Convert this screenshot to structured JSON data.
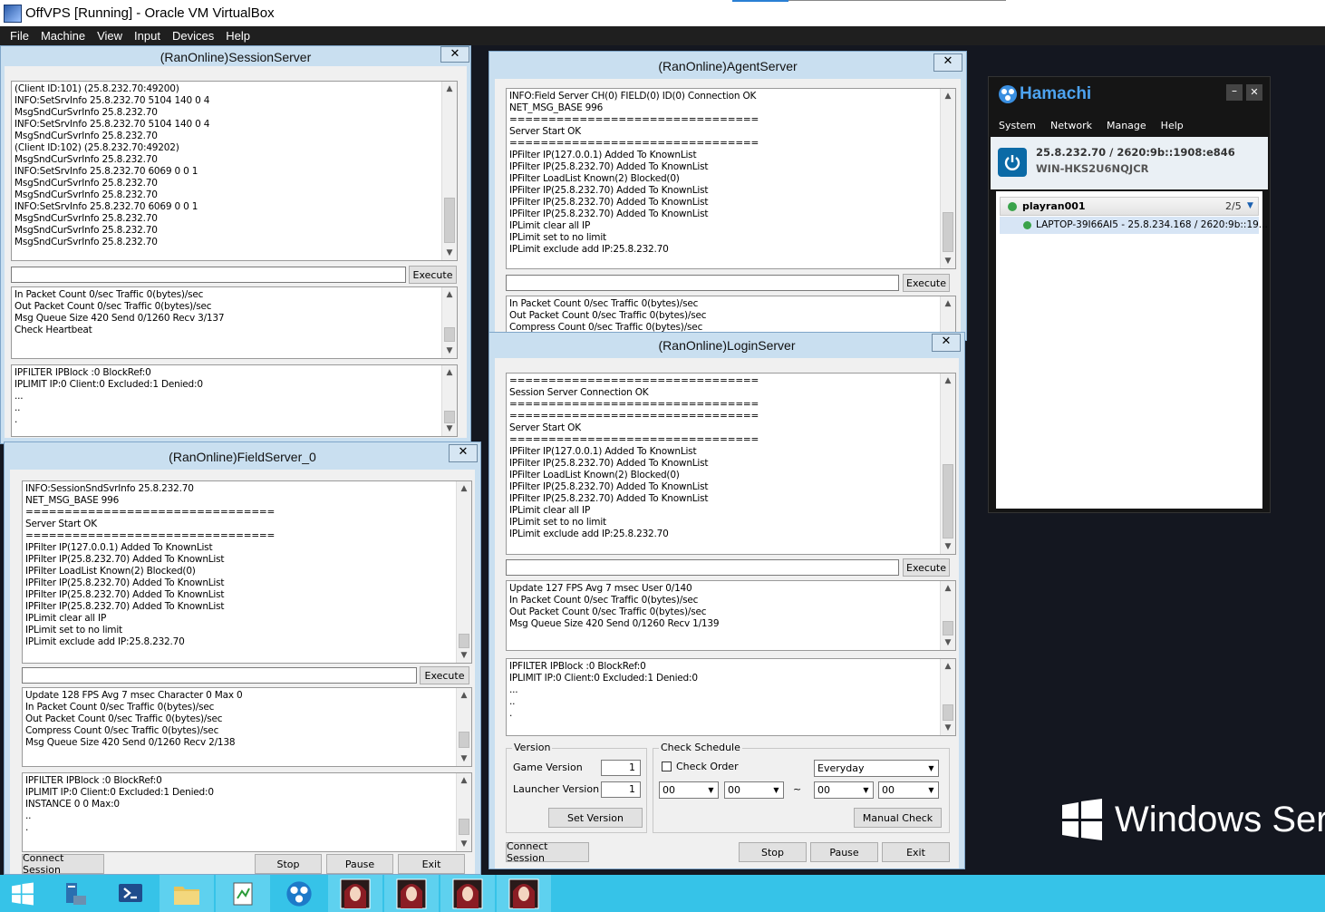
{
  "vbox": {
    "title": "OffVPS [Running] - Oracle VM VirtualBox",
    "menu": [
      "File",
      "Machine",
      "View",
      "Input",
      "Devices",
      "Help"
    ]
  },
  "common": {
    "execute": "Execute",
    "close_glyph": "✕",
    "up": "▲",
    "down": "▼"
  },
  "session": {
    "title": "(RanOnline)SessionServer",
    "log": [
      "(Client ID:101) (25.8.232.70:49200)",
      "INFO:SetSrvInfo 25.8.232.70 5104 140 0 4",
      "MsgSndCurSvrInfo 25.8.232.70",
      "INFO:SetSrvInfo 25.8.232.70 5104 140 0 4",
      "MsgSndCurSvrInfo 25.8.232.70",
      "(Client ID:102) (25.8.232.70:49202)",
      "MsgSndCurSvrInfo 25.8.232.70",
      "INFO:SetSrvInfo 25.8.232.70 6069 0 0 1",
      "MsgSndCurSvrInfo 25.8.232.70",
      "MsgSndCurSvrInfo 25.8.232.70",
      "INFO:SetSrvInfo 25.8.232.70 6069 0 0 1",
      "MsgSndCurSvrInfo 25.8.232.70",
      "MsgSndCurSvrInfo 25.8.232.70",
      "MsgSndCurSvrInfo 25.8.232.70"
    ],
    "stats": [
      "In Packet Count 0/sec Traffic 0(bytes)/sec",
      "Out Packet Count 0/sec Traffic 0(bytes)/sec",
      "Msg Queue Size 420 Send 0/1260 Recv 3/137",
      "Check Heartbeat"
    ],
    "ipf": [
      "IPFILTER IPBlock :0 BlockRef:0",
      "IPLIMIT IP:0 Client:0 Excluded:1 Denied:0",
      "...",
      "..",
      "."
    ]
  },
  "agent": {
    "title": "(RanOnline)AgentServer",
    "log": [
      "INFO:Field Server CH(0) FIELD(0) ID(0) Connection OK",
      "NET_MSG_BASE 996",
      "================================",
      "Server Start OK",
      "================================",
      "IPFilter IP(127.0.0.1) Added To KnownList",
      "IPFilter IP(25.8.232.70) Added To KnownList",
      "IPFilter LoadList Known(2) Blocked(0)",
      "IPFilter IP(25.8.232.70) Added To KnownList",
      "IPFilter IP(25.8.232.70) Added To KnownList",
      "IPFilter IP(25.8.232.70) Added To KnownList",
      "IPLimit clear all IP",
      "IPLimit set to no limit",
      "IPLimit exclude add IP:25.8.232.70"
    ],
    "stats": [
      "In Packet Count 0/sec Traffic 0(bytes)/sec",
      "Out Packet Count 0/sec Traffic 0(bytes)/sec",
      "Compress Count 0/sec Traffic 0(bytes)/sec"
    ]
  },
  "field": {
    "title": "(RanOnline)FieldServer_0",
    "log": [
      "INFO:SessionSndSvrInfo 25.8.232.70",
      "NET_MSG_BASE 996",
      "================================",
      "Server Start OK",
      "================================",
      "IPFilter IP(127.0.0.1) Added To KnownList",
      "IPFilter IP(25.8.232.70) Added To KnownList",
      "IPFilter LoadList Known(2) Blocked(0)",
      "IPFilter IP(25.8.232.70) Added To KnownList",
      "IPFilter IP(25.8.232.70) Added To KnownList",
      "IPFilter IP(25.8.232.70) Added To KnownList",
      "IPLimit clear all IP",
      "IPLimit set to no limit",
      "IPLimit exclude add IP:25.8.232.70"
    ],
    "stats": [
      "Update 128 FPS Avg 7 msec Character 0 Max 0",
      "In Packet Count 0/sec Traffic 0(bytes)/sec",
      "Out Packet Count 0/sec Traffic 0(bytes)/sec",
      "Compress Count 0/sec Traffic 0(bytes)/sec",
      "Msg Queue Size 420 Send 0/1260 Recv 2/138"
    ],
    "ipf": [
      "IPFILTER IPBlock :0 BlockRef:0",
      "IPLIMIT IP:0 Client:0 Excluded:1 Denied:0",
      "INSTANCE 0 0 Max:0",
      "..",
      "."
    ],
    "buttons": {
      "connect": "Connect Session",
      "stop": "Stop",
      "pause": "Pause",
      "exit": "Exit"
    }
  },
  "login": {
    "title": "(RanOnline)LoginServer",
    "log": [
      "================================",
      "Session Server Connection OK",
      "================================",
      "================================",
      "Server Start OK",
      "================================",
      "IPFilter IP(127.0.0.1) Added To KnownList",
      "IPFilter IP(25.8.232.70) Added To KnownList",
      "IPFilter LoadList Known(2) Blocked(0)",
      "IPFilter IP(25.8.232.70) Added To KnownList",
      "IPFilter IP(25.8.232.70) Added To KnownList",
      "IPLimit clear all IP",
      "IPLimit set to no limit",
      "IPLimit exclude add IP:25.8.232.70"
    ],
    "stats": [
      "Update 127 FPS Avg 7 msec User 0/140",
      "In Packet Count 0/sec Traffic 0(bytes)/sec",
      "Out Packet Count 0/sec Traffic 0(bytes)/sec",
      "Msg Queue Size 420 Send 0/1260 Recv 1/139"
    ],
    "ipf": [
      "IPFILTER IPBlock :0 BlockRef:0",
      "IPLIMIT IP:0 Client:0 Excluded:1 Denied:0",
      "...",
      "..",
      "."
    ],
    "version": {
      "group": "Version",
      "game_label": "Game Version",
      "game_value": "1",
      "launcher_label": "Launcher Version",
      "launcher_value": "1",
      "set_button": "Set Version"
    },
    "schedule": {
      "group": "Check Schedule",
      "check_order": "Check Order",
      "frequency": "Everyday",
      "h1": "00",
      "m1": "00",
      "tilde": "~",
      "h2": "00",
      "m2": "00",
      "manual_button": "Manual Check"
    },
    "buttons": {
      "connect": "Connect Session",
      "stop": "Stop",
      "pause": "Pause",
      "exit": "Exit"
    }
  },
  "hamachi": {
    "logo": "Hamachi",
    "menu": [
      "System",
      "Network",
      "Manage",
      "Help"
    ],
    "ip": "25.8.232.70 / 2620:9b::1908:e846",
    "host": "WIN-HKS2U6NQJCR",
    "network": {
      "name": "playran001",
      "count": "2/5"
    },
    "peer": "LAPTOP-39I66AI5 - 25.8.234.168 / 2620:9b::19..."
  },
  "branding": {
    "text": "Windows Serv"
  }
}
